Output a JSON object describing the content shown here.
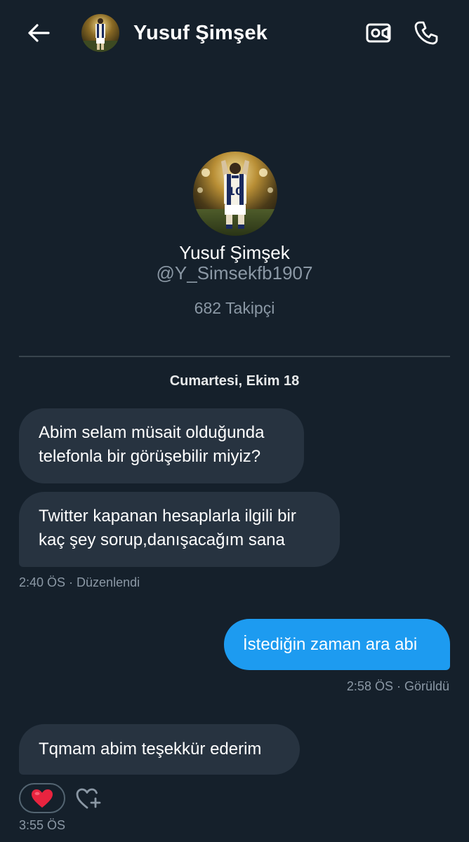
{
  "header": {
    "back_icon": "arrow-left-icon",
    "name": "Yusuf Şimşek",
    "video_icon": "video-camera-icon",
    "call_icon": "phone-icon"
  },
  "profile": {
    "name": "Yusuf Şimşek",
    "handle": "@Y_Simsekfb1907",
    "followers": "682 Takipçi"
  },
  "conversation": {
    "date_label": "Cumartesi, Ekim 18",
    "messages": [
      {
        "from": "them",
        "lines": [
          "Abim selam müsait olduğunda",
          "telefonla bir görüşebilir miyiz?"
        ]
      },
      {
        "from": "them",
        "lines": [
          "Twitter kapanan hesaplarla ilgili bir",
          "kaç şey sorup,danışacağım sana"
        ],
        "meta": "2:40 ÖS · Düzenlendi"
      },
      {
        "from": "me",
        "lines": [
          "İstediğin zaman ara abi"
        ],
        "meta": "2:58 ÖS · Görüldü",
        "color": "#1d9bf0"
      },
      {
        "from": "them",
        "lines": [
          "Tqmam abim teşekkür ederim"
        ],
        "reaction": "❤️",
        "add_reaction_icon": "heart-plus-icon",
        "meta": "3:55 ÖS"
      }
    ]
  },
  "colors": {
    "background": "#15202b",
    "bubble_them": "#273340",
    "bubble_me": "#1d9bf0",
    "muted_text": "#8b98a5"
  }
}
